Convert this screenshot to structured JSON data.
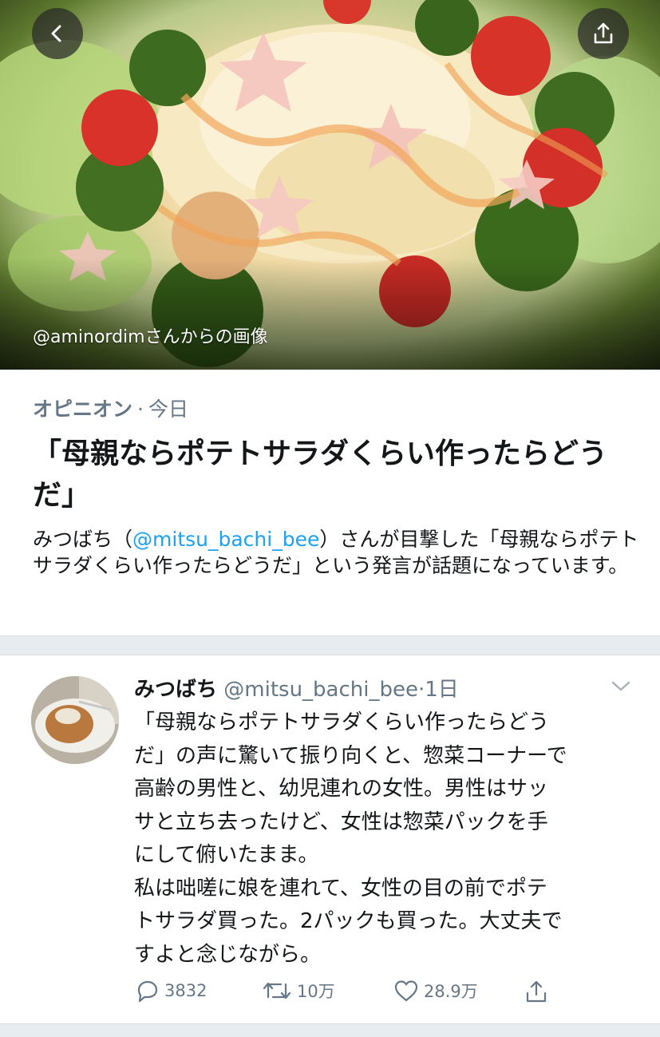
{
  "hero": {
    "image_credit": "@aminordimさんからの画像",
    "back_icon": "chevron-left-icon",
    "share_icon": "share-icon"
  },
  "article": {
    "category": "オピニオン",
    "separator": "·",
    "date": "今日",
    "headline": "「母親ならポテトサラダくらい作ったらどうだ」",
    "desc_before": "みつばち（",
    "desc_mention": "@mitsu_bachi_bee",
    "desc_after": "）さんが目撃した「母親ならポテトサラダくらい作ったらどうだ」という発言が話題になっています。"
  },
  "tweet": {
    "display_name": "みつばち",
    "handle": "@mitsu_bachi_bee",
    "separator": "·",
    "time": "1日",
    "text": "「母親ならポテトサラダくらい作ったらどう\nだ」の声に驚いて振り向くと、惣菜コーナーで\n高齢の男性と、幼児連れの女性。男性はサッ\nサと立ち去ったけど、女性は惣菜パックを手\nにして俯いたまま。\n私は咄嗟に娘を連れて、女性の目の前でポテ\nトサラダ買った。2パックも買った。大丈夫で\nすよと念じながら。",
    "replies": "3832",
    "retweets": "10万",
    "likes": "28.9万"
  },
  "colors": {
    "accent": "#1da1f2",
    "secondary_text": "#657786",
    "divider": "#e6ecf0"
  }
}
